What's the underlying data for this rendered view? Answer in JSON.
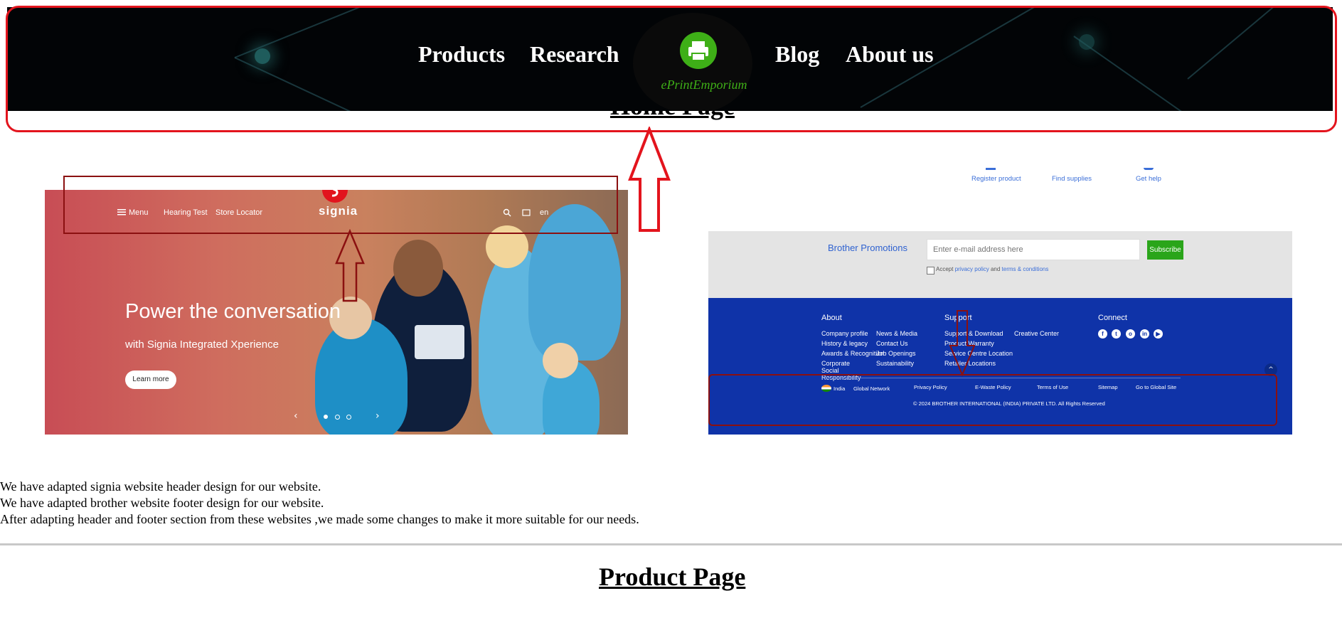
{
  "header": {
    "nav_left": [
      "Products",
      "Research"
    ],
    "nav_right": [
      "Blog",
      "About us"
    ],
    "logo_text": "ePrintEmporium",
    "logo_icon": "printer-icon"
  },
  "home": {
    "title": "Home Page"
  },
  "signia": {
    "menu_label": "Menu",
    "nav_items": [
      "Hearing Test",
      "Store Locator"
    ],
    "brand": "signia",
    "brand_icon": "signia-s-icon",
    "lang": "en",
    "hero_title": "Power the conversation",
    "hero_subtitle": "with Signia Integrated Xperience",
    "cta_label": "Learn more"
  },
  "brother": {
    "top_links": [
      "Register product",
      "Find supplies",
      "Get help"
    ],
    "promotions_title": "Brother Promotions",
    "email_placeholder": "Enter e-mail address here",
    "subscribe_label": "Subscribe",
    "accept_prefix": "Accept",
    "privacy_link": "privacy policy",
    "accept_and": "and",
    "terms_link": "terms & conditions",
    "columns": {
      "about": {
        "title": "About",
        "col1": [
          "Company profile",
          "History & legacy",
          "Awards & Recognition",
          "Corporate Social Responsibility"
        ],
        "col2": [
          "News & Media",
          "Contact Us",
          "Job Openings",
          "Sustainability"
        ]
      },
      "support": {
        "title": "Support",
        "col1": [
          "Support & Download",
          "Product Warranty",
          "Service Centre Location",
          "Retailer Locations"
        ],
        "col2": [
          "Creative Center"
        ]
      },
      "connect": {
        "title": "Connect",
        "icons": [
          "facebook-icon",
          "twitter-icon",
          "instagram-icon",
          "linkedin-icon",
          "youtube-icon"
        ]
      }
    },
    "bottom": {
      "country": "India",
      "global_network": "Global Network",
      "links": [
        "Privacy Policy",
        "E-Waste Policy",
        "Terms of Use",
        "Sitemap",
        "Go to Global Site"
      ],
      "copyright": "© 2024 BROTHER INTERNATIONAL (INDIA) PRIVATE LTD. All Rights Reserved"
    }
  },
  "notes": [
    "We have adapted signia website header design for our website.",
    "We have adapted brother website footer design for our website.",
    "After adapting header and footer section from these websites ,we made some changes to make it more suitable for our needs."
  ],
  "product": {
    "title": "Product Page"
  },
  "colors": {
    "annotation_red": "#e3141d",
    "logo_green": "#3eaf17",
    "brother_blue": "#0f33a8",
    "subscribe_green": "#2aa51a"
  }
}
